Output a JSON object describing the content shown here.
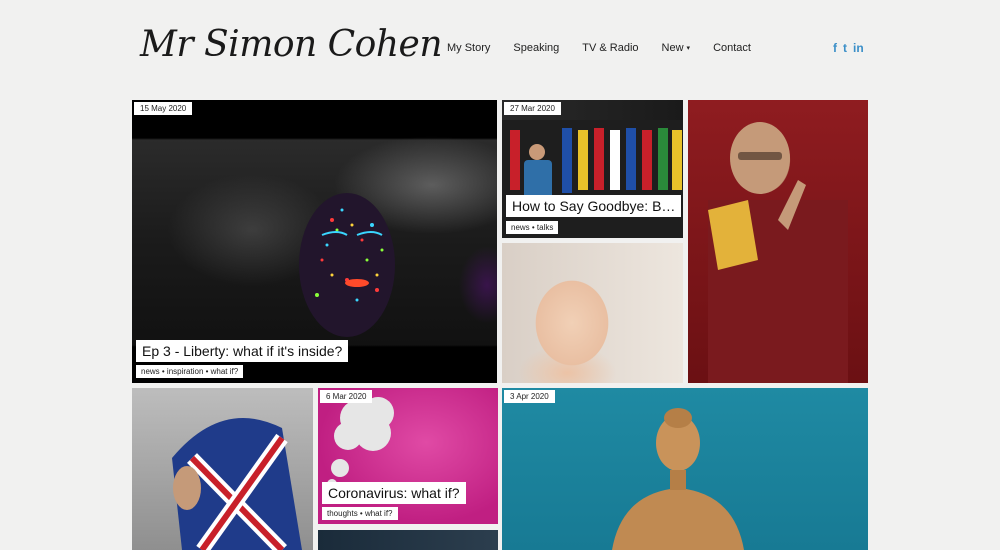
{
  "site": {
    "logo_text": "Mr Simon Cohen"
  },
  "nav": {
    "items": [
      {
        "label": "My Story"
      },
      {
        "label": "Speaking"
      },
      {
        "label": "TV & Radio"
      },
      {
        "label": "New"
      },
      {
        "label": "Contact"
      }
    ],
    "dropdown_caret": "▾"
  },
  "social": {
    "facebook": "f",
    "twitter": "t",
    "linkedin": "in",
    "color": "#3b8fc8"
  },
  "tiles": {
    "feature": {
      "date": "15 May 2020",
      "title": "Ep 3 - Liberty: what if it's inside?",
      "tags": "news • inspiration • what if?"
    },
    "stage": {
      "date": "27 Mar 2020",
      "title": "How to Say Goodbye: B…",
      "tags": "news • talks"
    },
    "coronavirus": {
      "date": "6 Mar 2020",
      "title": "Coronavirus: what if?",
      "tags": "thoughts • what if?"
    },
    "buddha": {
      "date": "3 Apr 2020"
    }
  }
}
